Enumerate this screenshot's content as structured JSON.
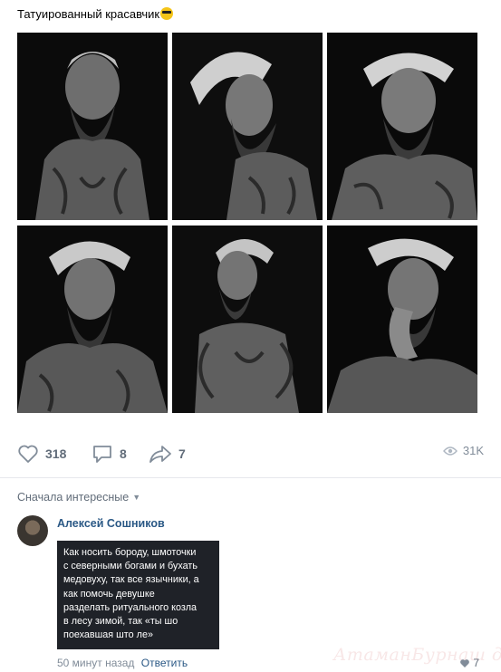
{
  "post": {
    "text": "Татуированный красавчик",
    "emoji": "sunglasses-emoji"
  },
  "photos": [
    {
      "id": "photo-1"
    },
    {
      "id": "photo-2"
    },
    {
      "id": "photo-3"
    },
    {
      "id": "photo-4"
    },
    {
      "id": "photo-5"
    },
    {
      "id": "photo-6"
    }
  ],
  "actions": {
    "likes": "318",
    "comments": "8",
    "shares": "7",
    "views": "31K",
    "icons": [
      "heart-icon",
      "comment-icon",
      "share-icon",
      "eye-icon"
    ]
  },
  "comments_section": {
    "sort_label": "Сначала интересные",
    "comment": {
      "author": "Алексей Сошников",
      "text": "Как носить бороду, шмоточки\nс северными богами и бухать\nмедовуху, так все язычники, а\nкак помочь девушке\nразделать ритуального козла\nв лесу зимой, так «ты шо\nпоехавшая што ле»",
      "time": "50 минут назад",
      "reply_label": "Ответить",
      "likes": "7"
    }
  },
  "watermark": "АтаманБурнаш для ЯП",
  "colors": {
    "link": "#2a5885",
    "muted": "#626d7a",
    "divider": "#e7e8ec",
    "comment_bg": "#1f2228"
  }
}
